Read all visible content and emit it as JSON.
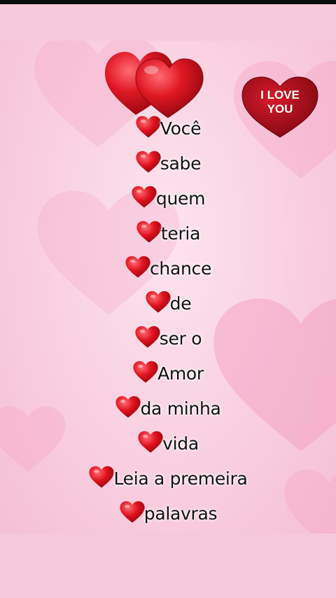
{
  "badge": {
    "line1": "I LOVE",
    "line2": "YOU"
  },
  "icons": {
    "heart": "red-heart-icon",
    "pair": "double-heart-icon"
  },
  "colors": {
    "heart": "#d8121f",
    "background": "#f8cfe0",
    "text": "#111111"
  },
  "words": [
    {
      "text": "Você"
    },
    {
      "text": "sabe"
    },
    {
      "text": "quem"
    },
    {
      "text": "teria"
    },
    {
      "text": "chance"
    },
    {
      "text": "de"
    },
    {
      "text": "ser o"
    },
    {
      "text": "Amor"
    },
    {
      "text": "da minha"
    },
    {
      "text": "vida"
    },
    {
      "text": "Leia a premeira"
    },
    {
      "text": "palavras"
    }
  ]
}
